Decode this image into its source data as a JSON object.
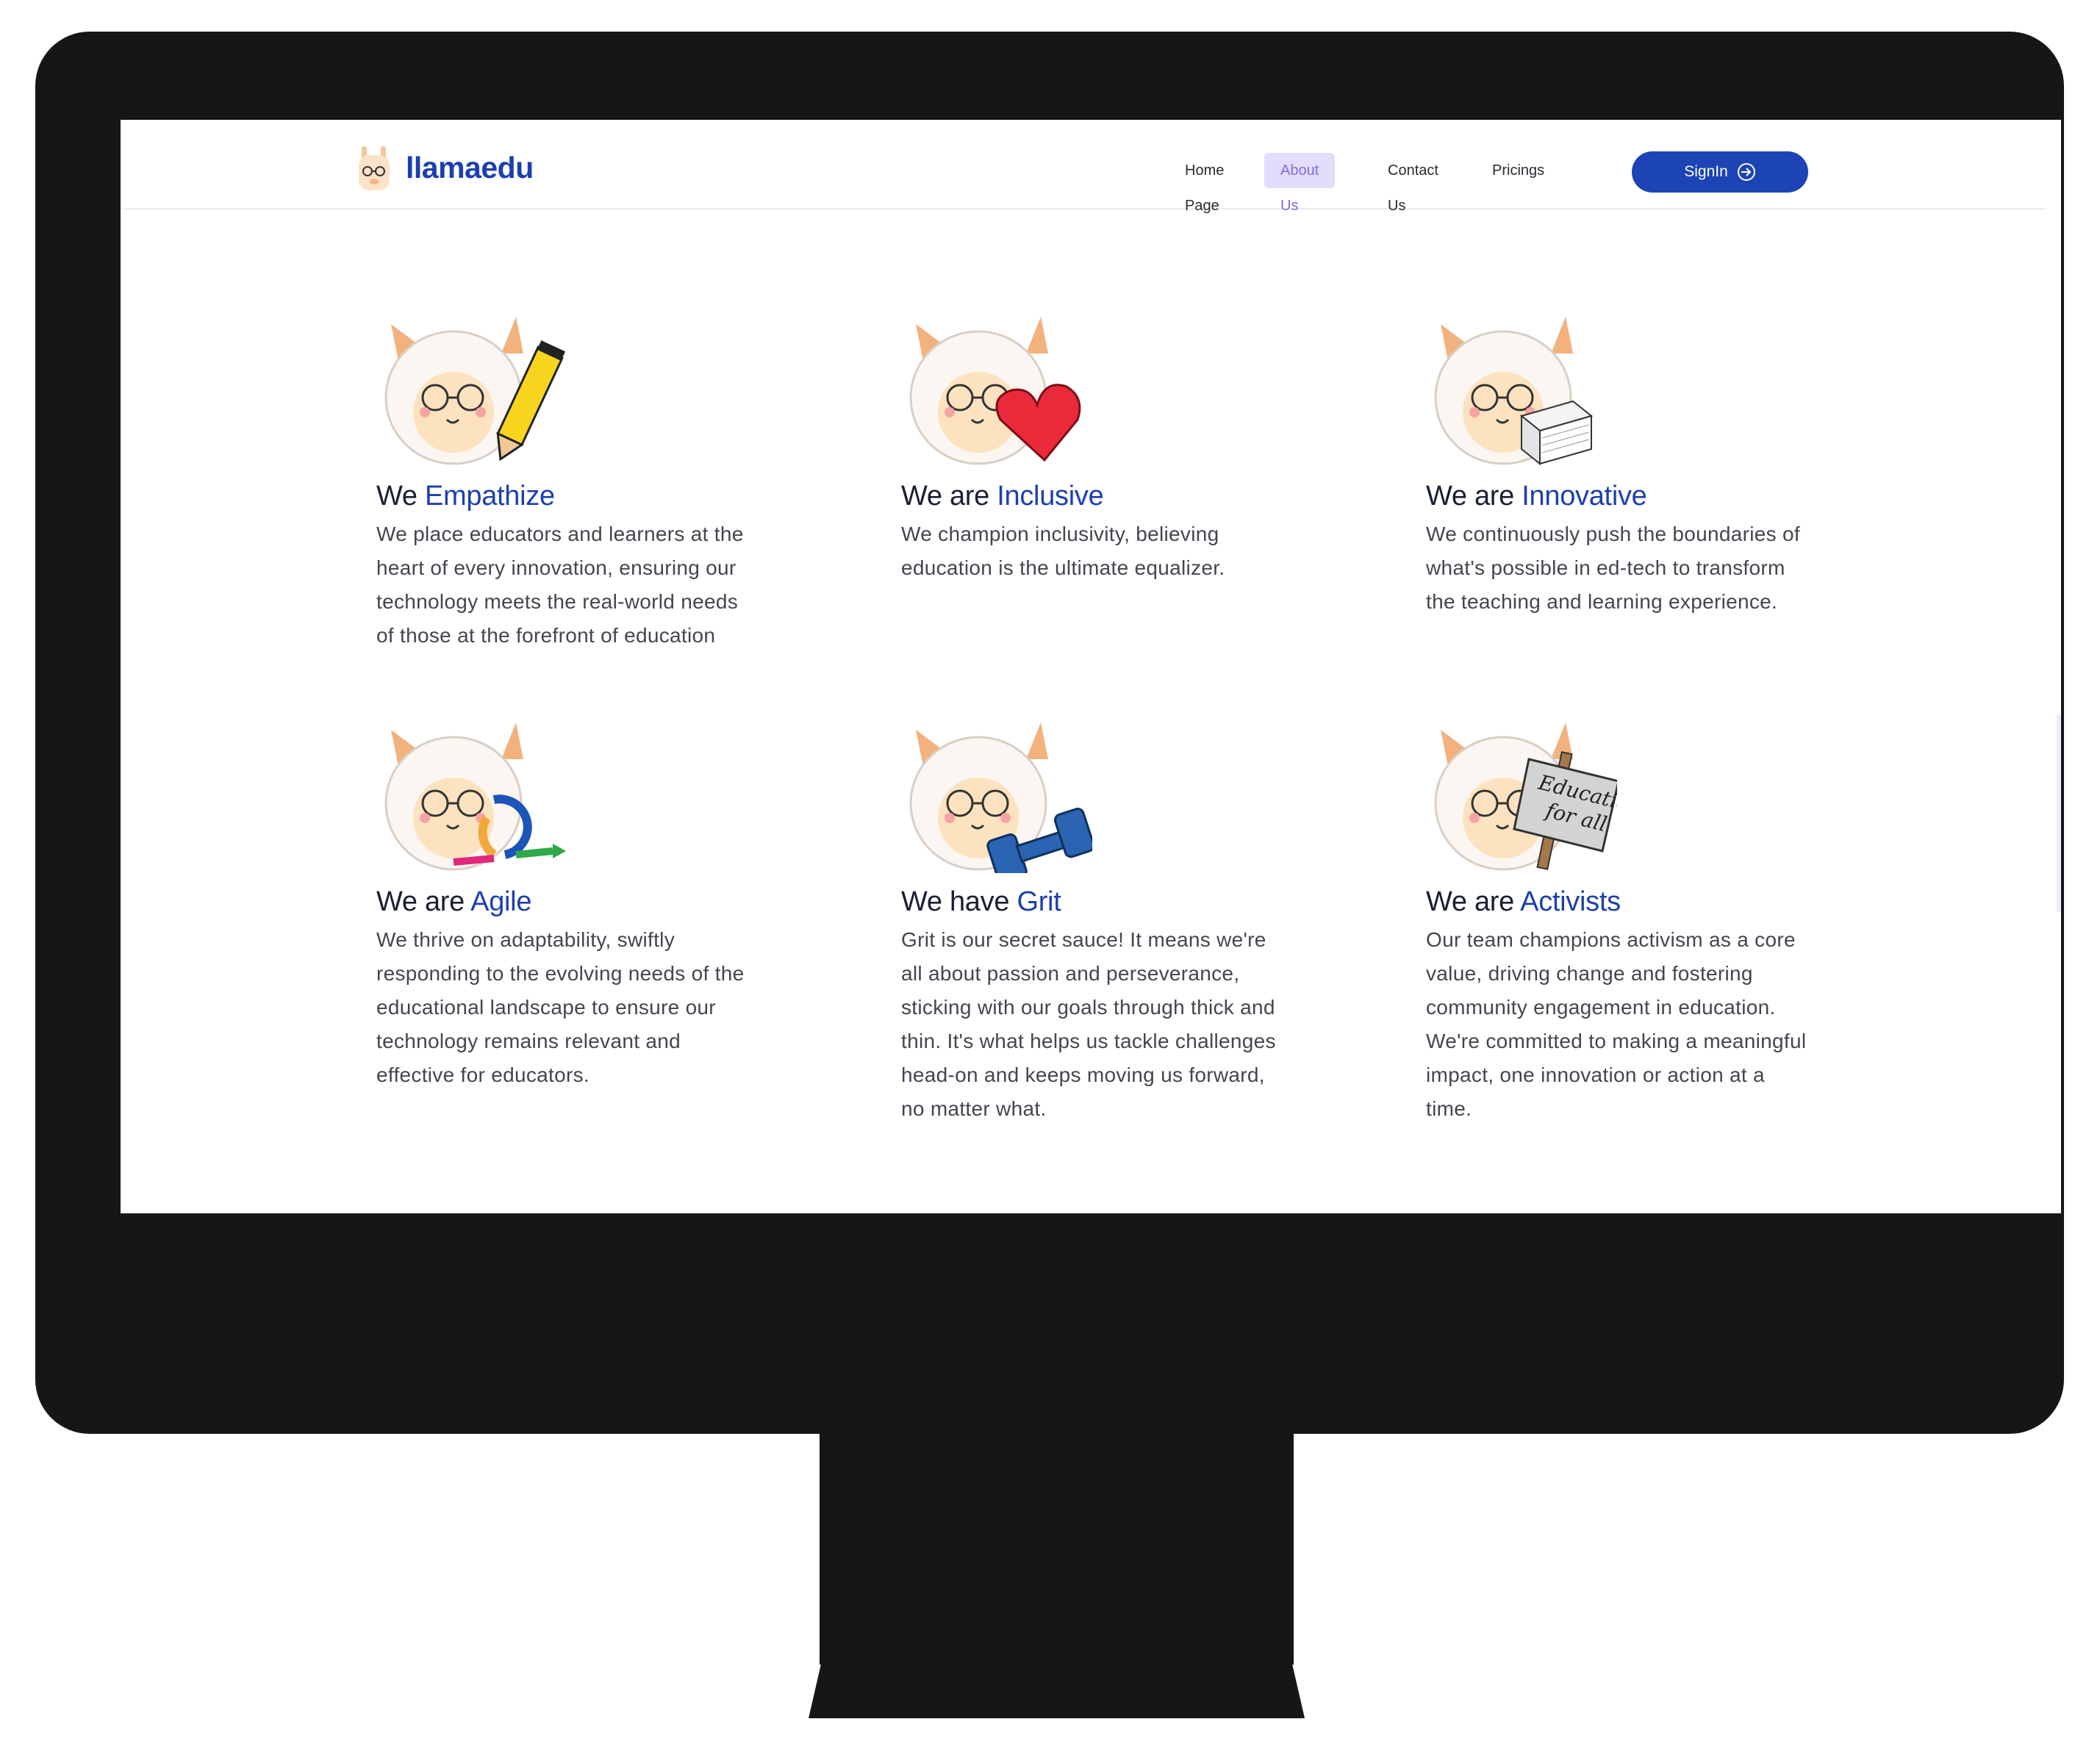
{
  "brand": {
    "name": "llamaedu"
  },
  "nav": {
    "links": [
      "Home Page",
      "About Us",
      "Contact Us",
      "Pricings"
    ],
    "active": "About Us",
    "signin_label": "SignIn"
  },
  "values": [
    {
      "prefix": "We ",
      "highlight": "Empathize",
      "icon": "pencil-icon",
      "text": "We place educators and learners at the heart of every innovation, ensuring our technology meets the real-world needs of those at the forefront of education"
    },
    {
      "prefix": "We are ",
      "highlight": "Inclusive",
      "icon": "heart-icon",
      "text": "We champion inclusivity, believing education is the ultimate equalizer."
    },
    {
      "prefix": "We are ",
      "highlight": "Innovative",
      "icon": "paper-stack-icon",
      "text": "We continuously push the boundaries of what's possible in ed-tech to transform the teaching and learning experience."
    },
    {
      "prefix": "We are ",
      "highlight": "Agile",
      "icon": "cycle-arrows-icon",
      "text": "We thrive on adaptability, swiftly responding to the evolving needs of the educational landscape to ensure our technology remains relevant and effective for educators."
    },
    {
      "prefix": "We have ",
      "highlight": "Grit",
      "icon": "dumbbell-icon",
      "text": "Grit is our secret sauce! It means we're all about passion and perseverance, sticking with our goals through thick and thin. It's what helps us tackle challenges head-on and keeps moving us forward, no matter what."
    },
    {
      "prefix": "We are ",
      "highlight": "Activists",
      "icon": "protest-sign-icon",
      "sign_text": "Education for all",
      "text": "Our team champions activism as a core value, driving change and fostering community engagement in education. We're committed to making a meaningful impact, one innovation or action at a time."
    }
  ],
  "colors": {
    "brand": "#1d3fae",
    "button": "#1c44b4",
    "active_tab_bg": "#e3dcfb",
    "active_tab_text": "#7b6fe0",
    "frame": "#161616"
  }
}
